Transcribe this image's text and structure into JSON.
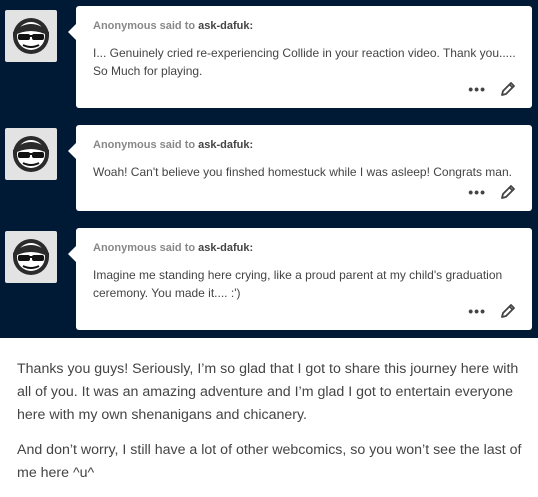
{
  "asks": [
    {
      "asker": "Anonymous",
      "said": "said to",
      "blog": "ask-dafuk",
      "colon": ":",
      "text": "I... Genuinely cried re-experiencing Collide in your reaction video. Thank you..... So Much for playing.",
      "more_glyph": "•••"
    },
    {
      "asker": "Anonymous",
      "said": "said to",
      "blog": "ask-dafuk",
      "colon": ":",
      "text": "Woah! Can't believe you finshed homestuck while I was asleep! Congrats man.",
      "more_glyph": "•••"
    },
    {
      "asker": "Anonymous",
      "said": "said to",
      "blog": "ask-dafuk",
      "colon": ":",
      "text": "Imagine me standing here crying, like a proud parent at my child's graduation ceremony. You made it.... :')",
      "more_glyph": "•••"
    }
  ],
  "answer": {
    "paragraphs": [
      "Thanks you guys! Seriously, I’m so glad that I got to share this journey here with all of you. It was an amazing adventure and I’m glad I got to entertain everyone here with my own shenanigans and chicanery.",
      "And don’t worry, I still have a lot of other webcomics, so you won’t see the last of me here ^u^"
    ]
  },
  "icons": {
    "avatar": "sunglasses-face-icon",
    "more": "more-dots-icon",
    "edit": "pencil-icon"
  },
  "colors": {
    "background_dark": "#001935",
    "bubble": "#ffffff",
    "text": "#444444",
    "header_text": "#888888"
  }
}
